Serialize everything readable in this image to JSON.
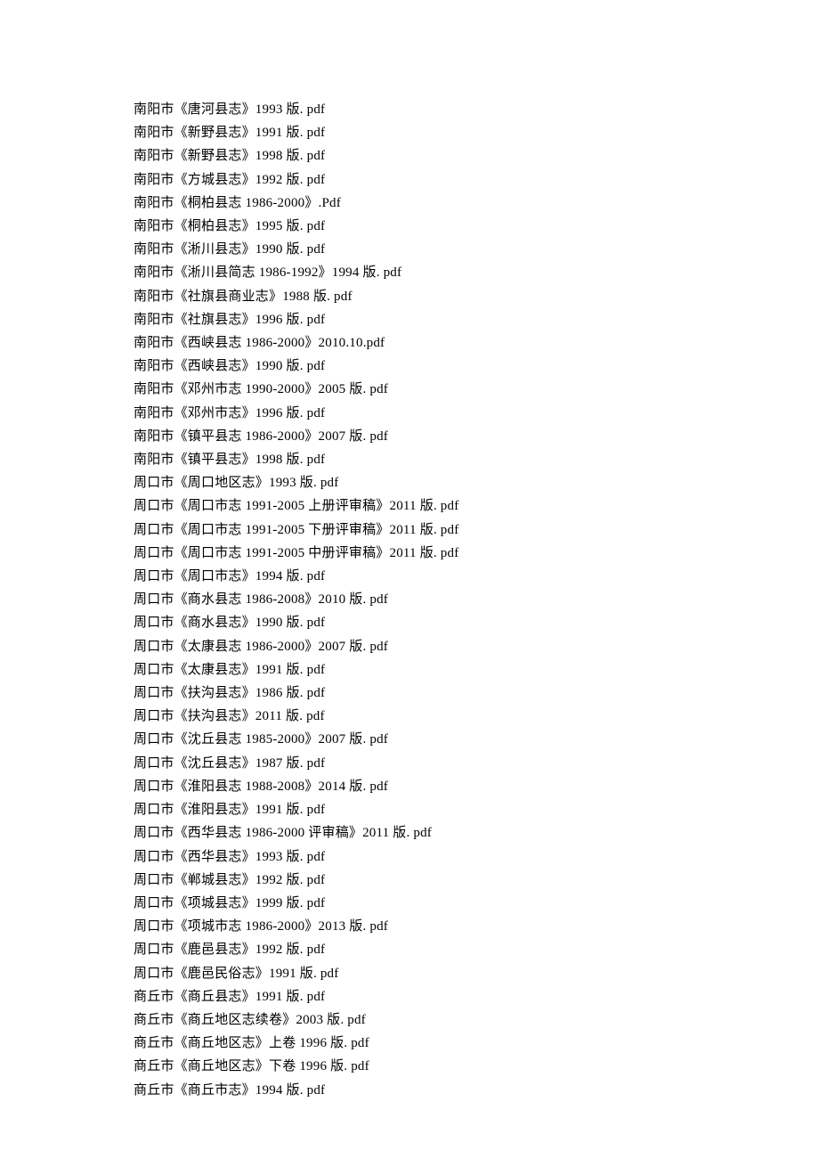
{
  "lines": [
    "南阳市《唐河县志》1993 版. pdf",
    "南阳市《新野县志》1991 版. pdf",
    "南阳市《新野县志》1998 版. pdf",
    "南阳市《方城县志》1992 版. pdf",
    "南阳市《桐柏县志 1986-2000》.Pdf",
    "南阳市《桐柏县志》1995 版. pdf",
    "南阳市《淅川县志》1990 版. pdf",
    "南阳市《淅川县简志 1986-1992》1994 版. pdf",
    "南阳市《社旗县商业志》1988 版. pdf",
    "南阳市《社旗县志》1996 版. pdf",
    "南阳市《西峡县志 1986-2000》2010.10.pdf",
    "南阳市《西峡县志》1990 版. pdf",
    "南阳市《邓州市志 1990-2000》2005 版. pdf",
    "南阳市《邓州市志》1996 版. pdf",
    "南阳市《镇平县志 1986-2000》2007 版. pdf",
    "南阳市《镇平县志》1998 版. pdf",
    "周口市《周口地区志》1993 版. pdf",
    "周口市《周口市志 1991-2005 上册评审稿》2011 版. pdf",
    "周口市《周口市志 1991-2005 下册评审稿》2011 版. pdf",
    "周口市《周口市志 1991-2005 中册评审稿》2011 版. pdf",
    "周口市《周口市志》1994 版. pdf",
    "周口市《商水县志 1986-2008》2010 版. pdf",
    "周口市《商水县志》1990 版. pdf",
    "周口市《太康县志 1986-2000》2007 版. pdf",
    "周口市《太康县志》1991 版. pdf",
    "周口市《扶沟县志》1986 版. pdf",
    "周口市《扶沟县志》2011 版. pdf",
    "周口市《沈丘县志 1985-2000》2007 版. pdf",
    "周口市《沈丘县志》1987 版. pdf",
    "周口市《淮阳县志 1988-2008》2014 版. pdf",
    "周口市《淮阳县志》1991 版. pdf",
    "周口市《西华县志 1986-2000 评审稿》2011 版. pdf",
    "周口市《西华县志》1993 版. pdf",
    "周口市《郸城县志》1992 版. pdf",
    "周口市《项城县志》1999 版. pdf",
    "周口市《项城市志 1986-2000》2013 版. pdf",
    "周口市《鹿邑县志》1992 版. pdf",
    "周口市《鹿邑民俗志》1991 版. pdf",
    "商丘市《商丘县志》1991 版. pdf",
    "商丘市《商丘地区志续卷》2003 版. pdf",
    "商丘市《商丘地区志》上卷 1996 版. pdf",
    "商丘市《商丘地区志》下卷 1996 版. pdf",
    "商丘市《商丘市志》1994 版. pdf"
  ]
}
